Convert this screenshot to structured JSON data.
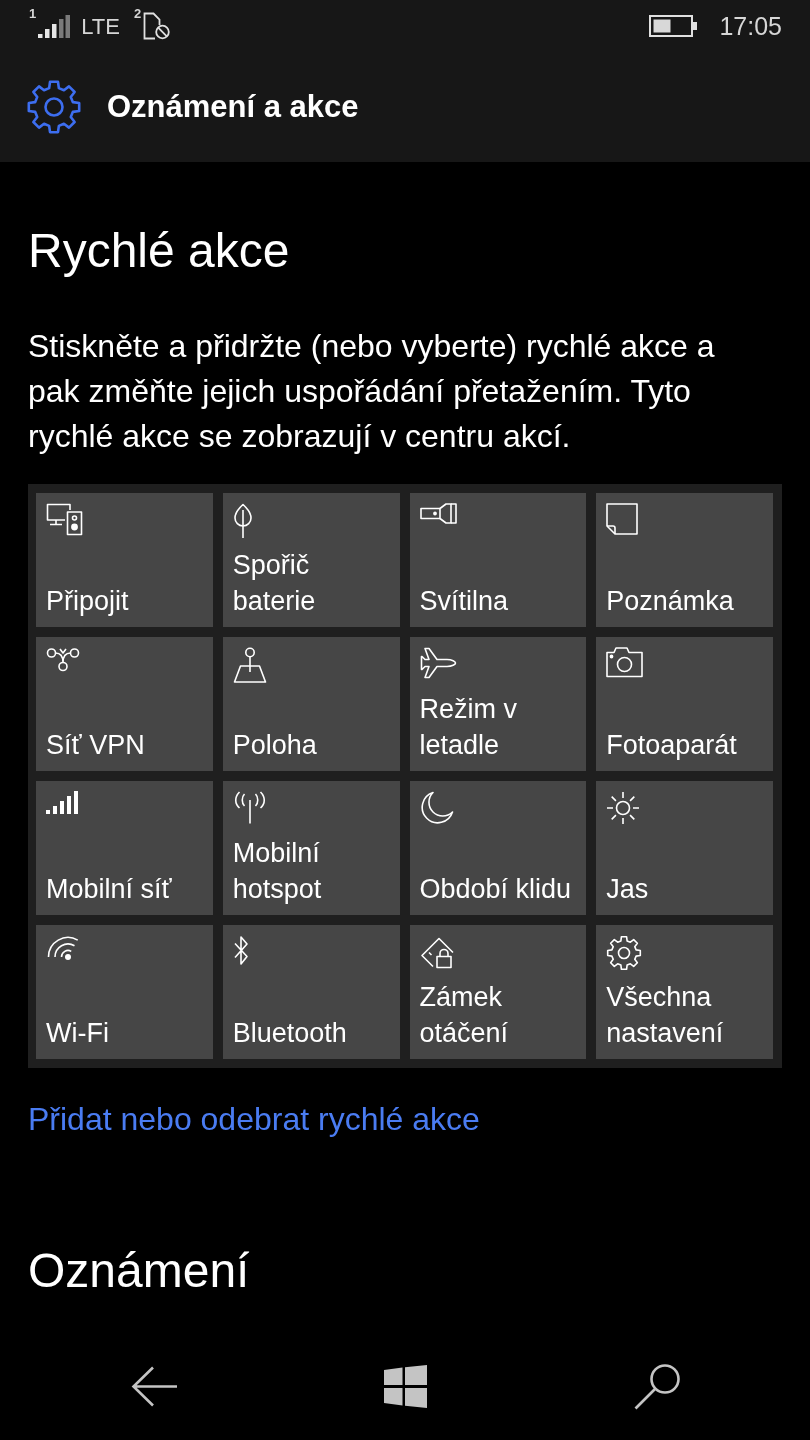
{
  "status_bar": {
    "sim1_label": "1",
    "network": "LTE",
    "sim2_label": "2",
    "time": "17:05"
  },
  "header": {
    "title": "Oznámení a akce"
  },
  "quick_actions": {
    "title": "Rychlé akce",
    "description": "Stiskněte a přidržte (nebo vyberte) rychlé akce a pak změňte jejich uspořádání přetažením. Tyto rychlé akce se zobrazují v centru akcí.",
    "tiles": [
      {
        "label": "Připojit"
      },
      {
        "label": "Spořič baterie"
      },
      {
        "label": "Svítilna"
      },
      {
        "label": "Poznámka"
      },
      {
        "label": "Síť VPN"
      },
      {
        "label": "Poloha"
      },
      {
        "label": "Režim v letadle"
      },
      {
        "label": "Fotoaparát"
      },
      {
        "label": "Mobilní síť"
      },
      {
        "label": "Mobilní hotspot"
      },
      {
        "label": "Období klidu"
      },
      {
        "label": "Jas"
      },
      {
        "label": "Wi-Fi"
      },
      {
        "label": "Bluetooth"
      },
      {
        "label": "Zámek otáčení"
      },
      {
        "label": "Všechna nastavení"
      }
    ],
    "link": "Přidat nebo odebrat rychlé akce"
  },
  "notifications": {
    "title": "Oznámení"
  }
}
